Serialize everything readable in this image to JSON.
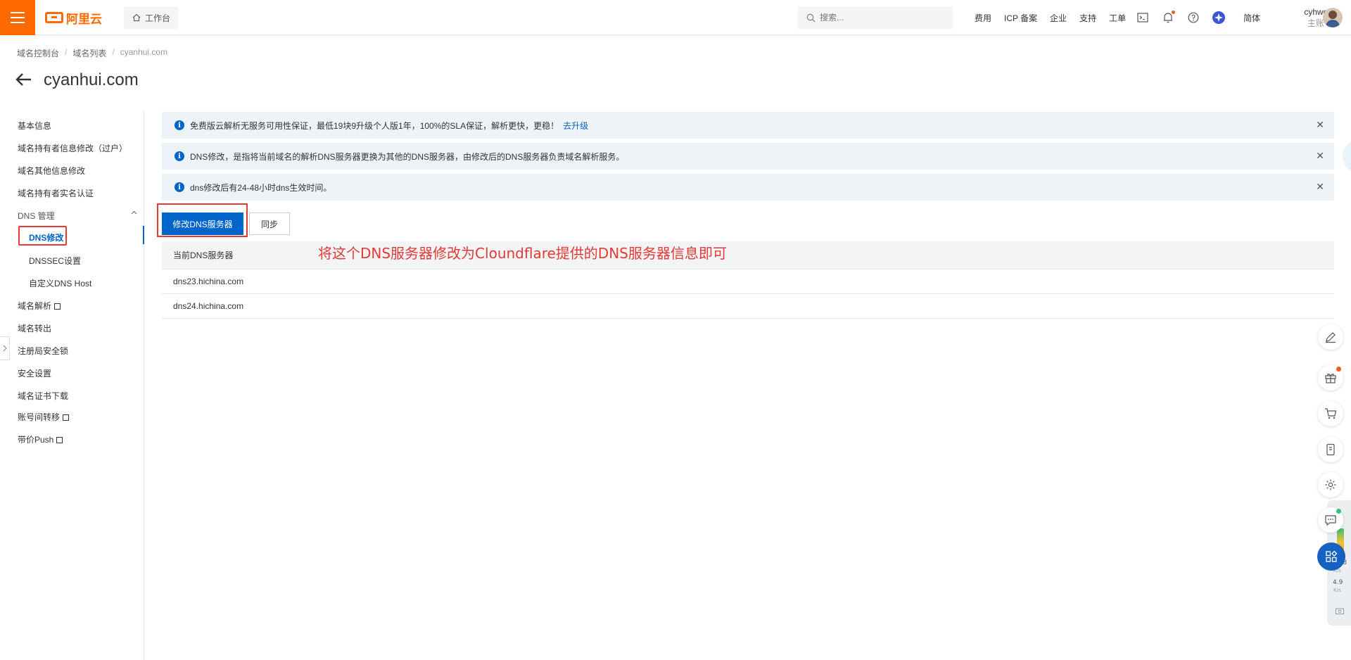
{
  "brand": {
    "name": "阿里云",
    "accent": "#ff6a00",
    "primary": "#0064c8",
    "annotation_color": "#e53935"
  },
  "header": {
    "workbench": "工作台",
    "search_placeholder": "搜索...",
    "links": [
      "费用",
      "ICP 备案",
      "企业",
      "支持",
      "工单"
    ],
    "icons": [
      "terminal-icon",
      "bell-icon",
      "help-icon",
      "ai-assistant-icon"
    ],
    "language": "简体",
    "user": {
      "name": "cyhweb",
      "type": "主账号"
    }
  },
  "breadcrumb": [
    "域名控制台",
    "域名列表",
    "cyanhui.com"
  ],
  "page": {
    "title": "cyanhui.com"
  },
  "sidebar": {
    "items": [
      {
        "label": "基本信息"
      },
      {
        "label": "域名持有者信息修改（过户）"
      },
      {
        "label": "域名其他信息修改"
      },
      {
        "label": "域名持有者实名认证"
      },
      {
        "label": "DNS 管理"
      },
      {
        "label": "DNS修改"
      },
      {
        "label": "DNSSEC设置"
      },
      {
        "label": "自定义DNS Host"
      },
      {
        "label": "域名解析"
      },
      {
        "label": "域名转出"
      },
      {
        "label": "注册局安全锁"
      },
      {
        "label": "安全设置"
      },
      {
        "label": "域名证书下载"
      },
      {
        "label": "账号间转移"
      },
      {
        "label": "带价Push"
      }
    ],
    "active": "DNS修改"
  },
  "alerts": [
    {
      "text": "免费版云解析无服务可用性保证，最低19块9升级个人版1年，100%的SLA保证，解析更快，更稳！",
      "link": "去升级"
    },
    {
      "text": "DNS修改，是指将当前域名的解析DNS服务器更换为其他的DNS服务器，由修改后的DNS服务器负责域名解析服务。"
    },
    {
      "text": "dns修改后有24-48小时dns生效时间。"
    }
  ],
  "actions": {
    "modify_dns": "修改DNS服务器",
    "sync": "同步"
  },
  "dns_table": {
    "header": "当前DNS服务器",
    "rows": [
      "dns23.hichina.com",
      "dns24.hichina.com"
    ]
  },
  "annotation": "将这个DNS服务器修改为Cloundflare提供的DNS服务器信息即可",
  "monitor": {
    "upload": "15.8",
    "upload_unit": "K/s",
    "download": "4.9",
    "download_unit": "K/s"
  }
}
